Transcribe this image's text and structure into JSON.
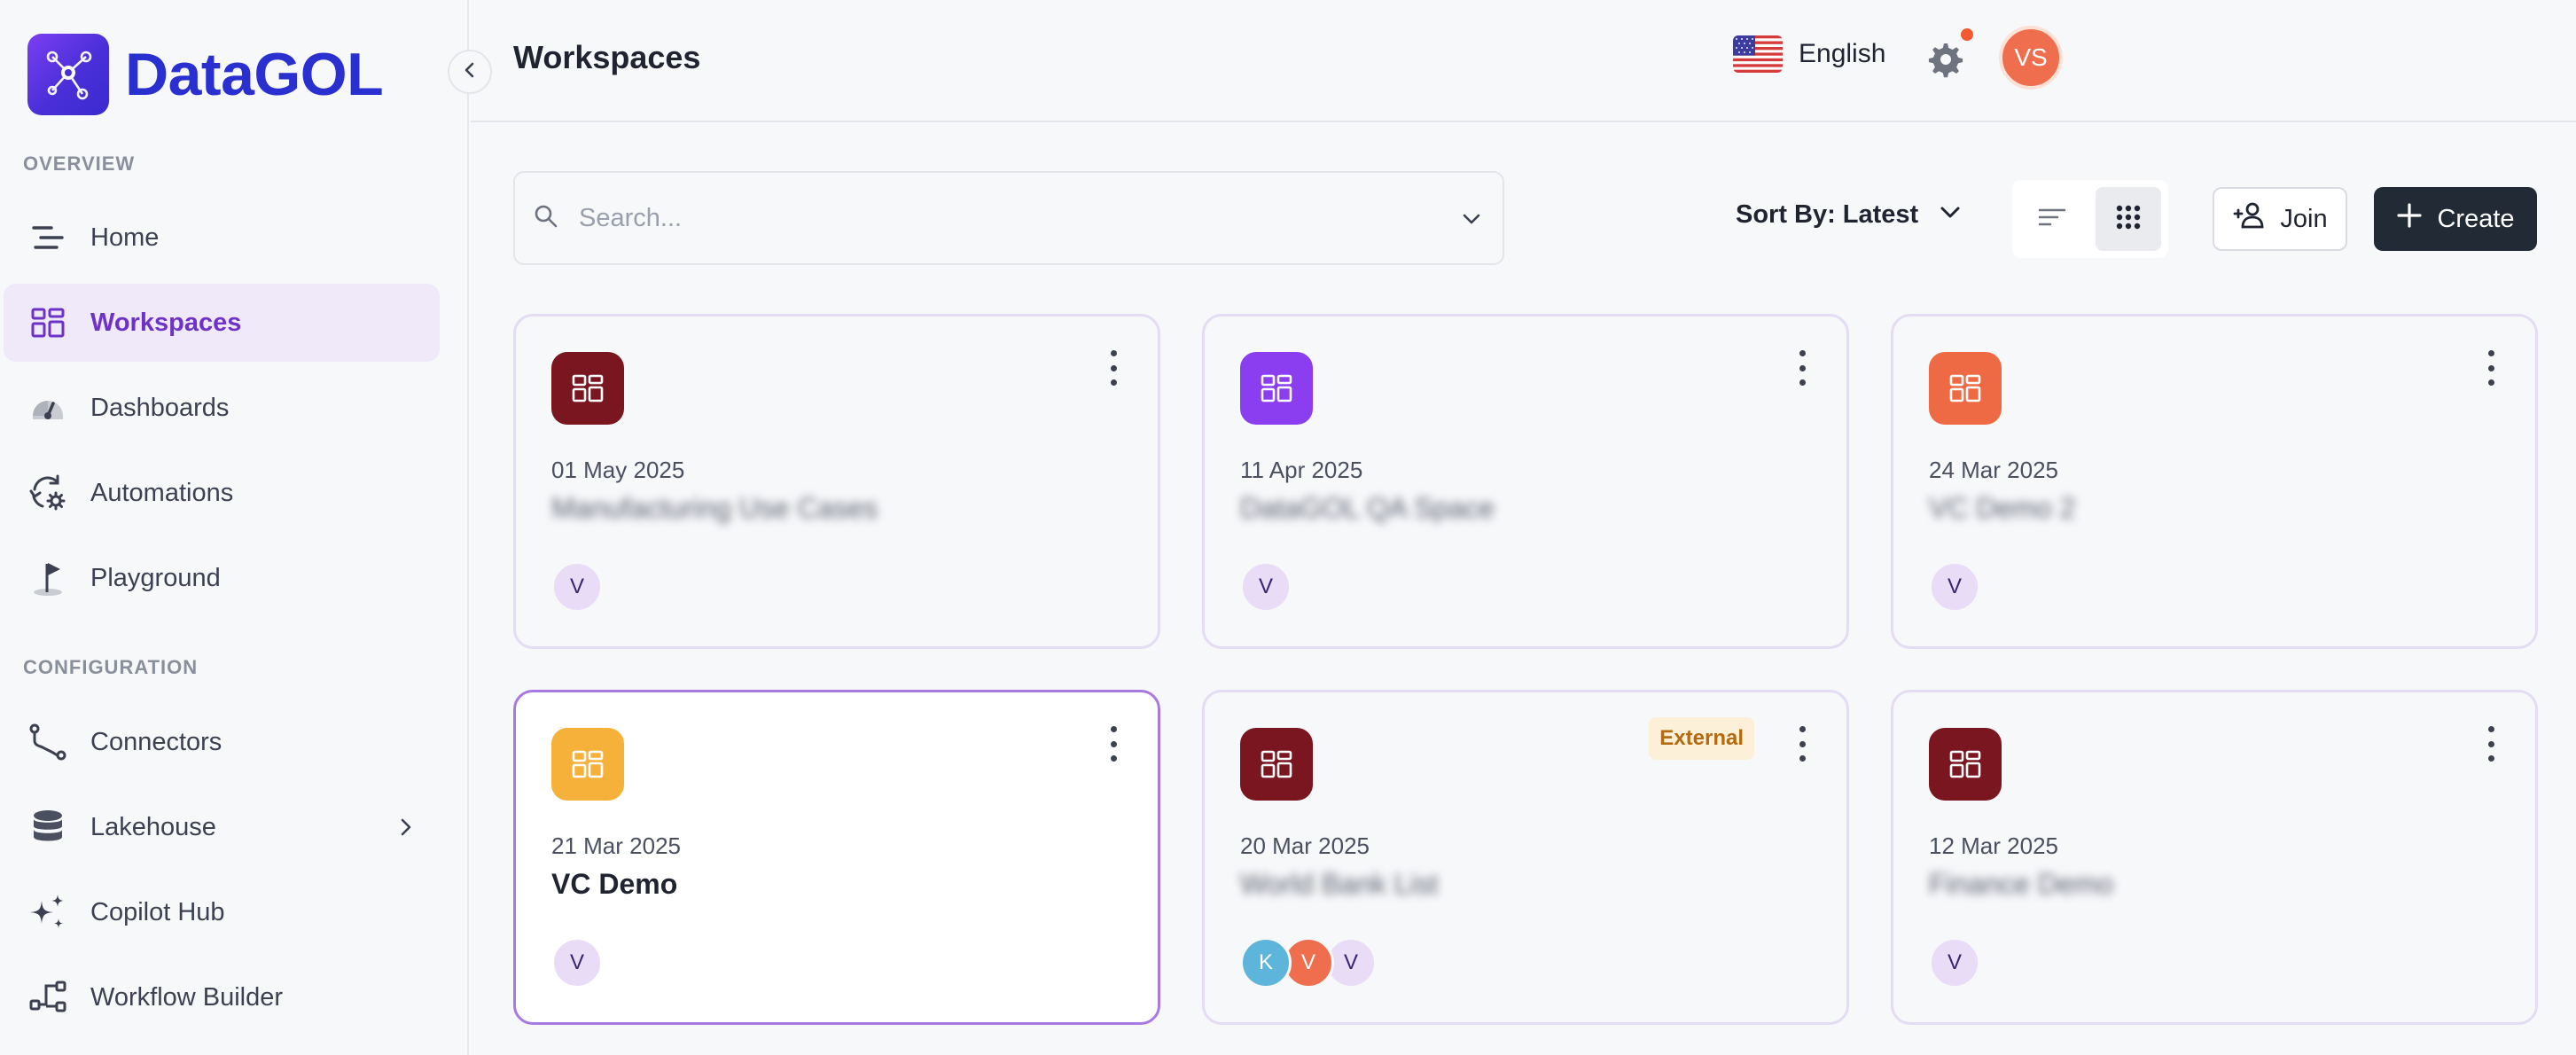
{
  "brand": {
    "name": "DataGOL"
  },
  "sidebar": {
    "sections": [
      {
        "label": "OVERVIEW",
        "items": [
          {
            "label": "Home",
            "icon": "home-lines-icon",
            "active": false
          },
          {
            "label": "Workspaces",
            "icon": "grid-icon",
            "active": true
          },
          {
            "label": "Dashboards",
            "icon": "gauge-icon",
            "active": false
          },
          {
            "label": "Automations",
            "icon": "cycle-gear-icon",
            "active": false
          },
          {
            "label": "Playground",
            "icon": "flag-icon",
            "active": false
          }
        ]
      },
      {
        "label": "CONFIGURATION",
        "items": [
          {
            "label": "Connectors",
            "icon": "connector-icon",
            "active": false
          },
          {
            "label": "Lakehouse",
            "icon": "database-icon",
            "active": false,
            "expandable": true
          },
          {
            "label": "Copilot Hub",
            "icon": "sparkle-icon",
            "active": false
          },
          {
            "label": "Workflow Builder",
            "icon": "workflow-icon",
            "active": false
          }
        ]
      }
    ]
  },
  "header": {
    "title": "Workspaces",
    "language": "English",
    "user_initials": "VS"
  },
  "toolbar": {
    "search_placeholder": "Search...",
    "sort_label": "Sort By:",
    "sort_value": "Latest",
    "join_label": "Join",
    "create_label": "Create"
  },
  "workspaces": [
    {
      "date": "01 May 2025",
      "title": "Manufacturing Use Cases",
      "blurred": true,
      "icon_color": "#7a1620",
      "members": [
        {
          "initial": "V",
          "bg": "#e8dcf6",
          "fg": "#3a2470"
        }
      ]
    },
    {
      "date": "11 Apr 2025",
      "title": "DataGOL QA Space",
      "blurred": true,
      "icon_color": "#8a3ef0",
      "members": [
        {
          "initial": "V",
          "bg": "#e8dcf6",
          "fg": "#3a2470"
        }
      ]
    },
    {
      "date": "24 Mar 2025",
      "title": "VC Demo 2",
      "blurred": true,
      "icon_color": "#ee6a45",
      "members": [
        {
          "initial": "V",
          "bg": "#e8dcf6",
          "fg": "#3a2470"
        }
      ]
    },
    {
      "date": "21 Mar 2025",
      "title": "VC Demo",
      "blurred": false,
      "icon_color": "#f5b13a",
      "selected": true,
      "members": [
        {
          "initial": "V",
          "bg": "#e8dcf6",
          "fg": "#3a2470"
        }
      ]
    },
    {
      "date": "20 Mar 2025",
      "title": "World Bank List",
      "blurred": true,
      "icon_color": "#7a1620",
      "badge": "External",
      "members": [
        {
          "initial": "K",
          "bg": "#5db5dc",
          "fg": "#ffffff"
        },
        {
          "initial": "V",
          "bg": "#ef6e4d",
          "fg": "#ffffff"
        },
        {
          "initial": "V",
          "bg": "#e8dcf6",
          "fg": "#3a2470"
        }
      ]
    },
    {
      "date": "12 Mar 2025",
      "title": "Finance Demo",
      "blurred": true,
      "icon_color": "#7a1620",
      "members": [
        {
          "initial": "V",
          "bg": "#e8dcf6",
          "fg": "#3a2470"
        }
      ]
    }
  ]
}
